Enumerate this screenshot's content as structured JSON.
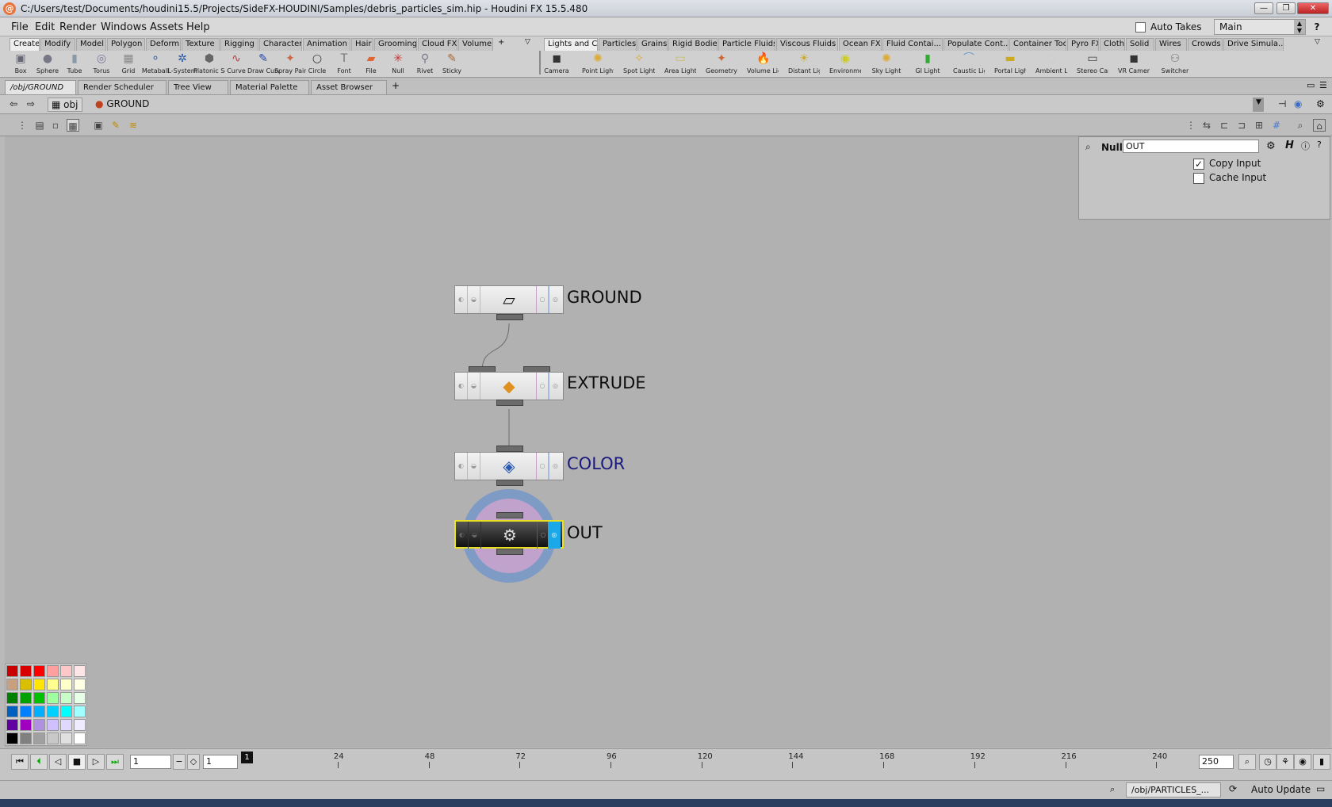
{
  "window": {
    "title": "C:/Users/test/Documents/houdini15.5/Projects/SideFX-HOUDINI/Samples/debris_particles_sim.hip - Houdini FX 15.5.480"
  },
  "menu": [
    "File",
    "Edit",
    "Render",
    "Windows",
    "Assets",
    "Help"
  ],
  "takes": {
    "auto_label": "Auto Takes",
    "current": "Main"
  },
  "shelf_left": {
    "tabs": [
      "Create",
      "Modify",
      "Model",
      "Polygon",
      "Deform",
      "Texture",
      "Rigging",
      "Character",
      "Animation",
      "Hair",
      "Grooming",
      "Cloud FX",
      "Volume"
    ],
    "tools": [
      "Box",
      "Sphere",
      "Tube",
      "Torus",
      "Grid",
      "Metaball",
      "L-System",
      "Platonic Sol...",
      "Curve",
      "Draw Curve",
      "Spray Paint",
      "Circle",
      "Font",
      "File",
      "Null",
      "Rivet",
      "Sticky"
    ]
  },
  "shelf_right": {
    "tabs": [
      "Lights and C...",
      "Particles",
      "Grains",
      "Rigid Bodies",
      "Particle Fluids",
      "Viscous Fluids",
      "Ocean FX",
      "Fluid Contai...",
      "Populate Cont...",
      "Container Tools",
      "Pyro FX",
      "Cloth",
      "Solid",
      "Wires",
      "Crowds",
      "Drive Simula..."
    ],
    "tools": [
      "Camera",
      "Point Light",
      "Spot Light",
      "Area Light",
      "Geometry L...",
      "Volume Light",
      "Distant Light",
      "Environme...",
      "Sky Light",
      "GI Light",
      "Caustic Light",
      "Portal Light",
      "Ambient Li...",
      "Stereo Cam...",
      "VR Camera",
      "Switcher"
    ]
  },
  "pane_tabs": [
    "/obj/GROUND",
    "Render Scheduler",
    "Tree View",
    "Material Palette",
    "Asset Browser"
  ],
  "path": {
    "root": "obj",
    "current": "GROUND"
  },
  "params": {
    "type": "Null",
    "name": "OUT",
    "copy_input": {
      "label": "Copy Input",
      "checked": true,
      "mark": "✓"
    },
    "cache_input": {
      "label": "Cache Input",
      "checked": false
    }
  },
  "nodes": [
    {
      "name": "GROUND",
      "icon": "ground-plane-icon",
      "color": "#0d0d0d"
    },
    {
      "name": "EXTRUDE",
      "icon": "extrude-box-icon",
      "color": "#0d0d0d"
    },
    {
      "name": "COLOR",
      "icon": "color-bucket-icon",
      "color": "#1a1a80"
    },
    {
      "name": "OUT",
      "icon": "gear-icon",
      "color": "#0d0d0d",
      "display": true
    }
  ],
  "palette_colors": [
    [
      "#c80000",
      "#d80000",
      "#ff0000",
      "#ffa0a0",
      "#ffc8c8",
      "#ffe6e6"
    ],
    [
      "#c8a080",
      "#d8c000",
      "#ffe600",
      "#ffff90",
      "#ffffc8",
      "#ffffe6"
    ],
    [
      "#008000",
      "#00a000",
      "#00c000",
      "#a0ffa0",
      "#c8ffc8",
      "#e6ffe6"
    ],
    [
      "#0060c0",
      "#0080ff",
      "#00b0ff",
      "#00d0ff",
      "#00ffff",
      "#a0ffff"
    ],
    [
      "#6000a0",
      "#a000c0",
      "#b090e0",
      "#d0c0ff",
      "#e0d8ff",
      "#f0ecff"
    ],
    [
      "#000000",
      "#808080",
      "#a0a0a0",
      "#c8c8c8",
      "#e0e0e0",
      "#ffffff"
    ]
  ],
  "timeline": {
    "current_frame": "1",
    "start": "1",
    "start2": "1",
    "end": "250",
    "ticks": [
      "24",
      "48",
      "72",
      "96",
      "120",
      "144",
      "168",
      "192",
      "216",
      "240"
    ]
  },
  "status": {
    "path": "/obj/PARTICLES_...",
    "update": "Auto Update"
  }
}
